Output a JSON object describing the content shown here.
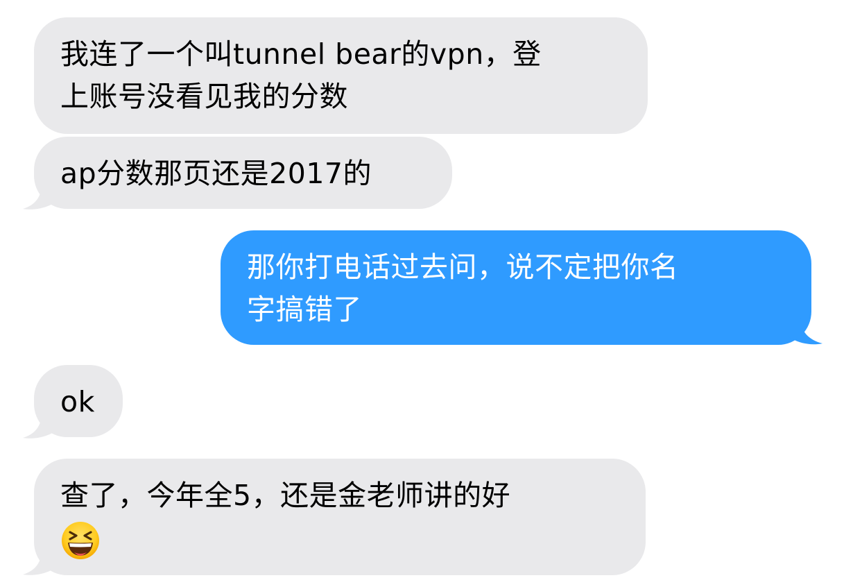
{
  "colors": {
    "incoming_bubble": "#e9e9eb",
    "outgoing_bubble": "#2f9bff",
    "incoming_text": "#000000",
    "outgoing_text": "#ffffff",
    "background": "#ffffff"
  },
  "messages": [
    {
      "direction": "incoming",
      "line1": "我连了一个叫tunnel bear的vpn，登",
      "line2": "上账号没看见我的分数"
    },
    {
      "direction": "incoming",
      "text": "ap分数那页还是2017的"
    },
    {
      "direction": "outgoing",
      "line1": "那你打电话过去问，说不定把你名",
      "line2": "字搞错了"
    },
    {
      "direction": "incoming",
      "text": "ok"
    },
    {
      "direction": "incoming",
      "line1": "查了，今年全5，还是金老师讲的好",
      "emoji": "grinning-squinting-face-emoji"
    }
  ]
}
